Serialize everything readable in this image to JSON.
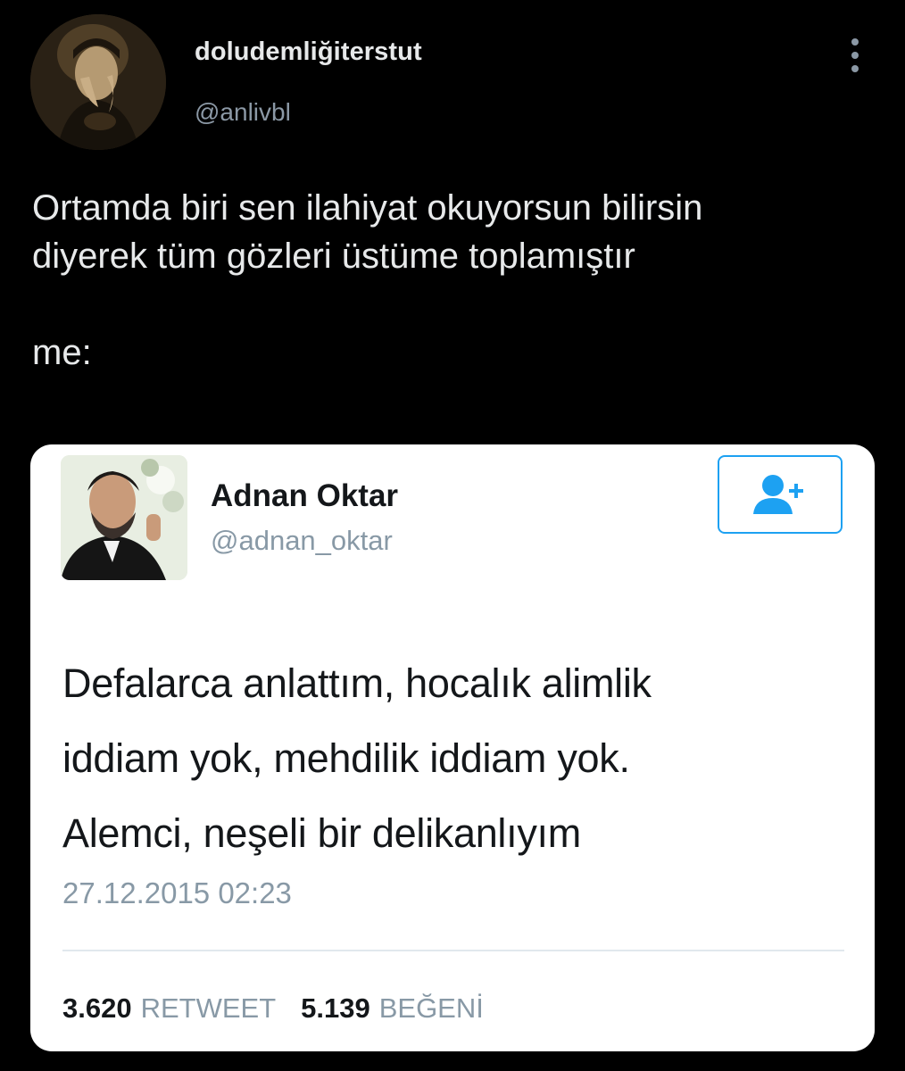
{
  "tweet": {
    "author": {
      "display_name": "doludemliğiterstut",
      "handle": "@anlivbl",
      "avatar_icon": "avatar-portrait"
    },
    "text": "Ortamda biri sen ilahiyat okuyorsun bilirsin\ndiyerek tüm gözleri üstüme toplamıştır\n\nme:",
    "more_icon": "more-vertical-icon"
  },
  "embedded_tweet": {
    "author": {
      "display_name": "Adnan Oktar",
      "handle": "@adnan_oktar"
    },
    "follow_icon": "add-user-icon",
    "text": "Defalarca anlattım, hocalık alimlik\niddiam yok, mehdilik iddiam yok.\nAlemci, neşeli bir delikanlıyım",
    "timestamp": "27.12.2015 02:23",
    "stats": {
      "retweets_count": "3.620",
      "retweets_label": "RETWEET",
      "likes_count": "5.139",
      "likes_label": "BEĞENİ"
    }
  },
  "colors": {
    "background": "#000000",
    "primary_text_dark": "#e7e9ea",
    "secondary_text_dark": "#8b98a5",
    "card_background": "#ffffff",
    "twitter_blue": "#1da1f2",
    "secondary_text_light": "#8899a6"
  }
}
